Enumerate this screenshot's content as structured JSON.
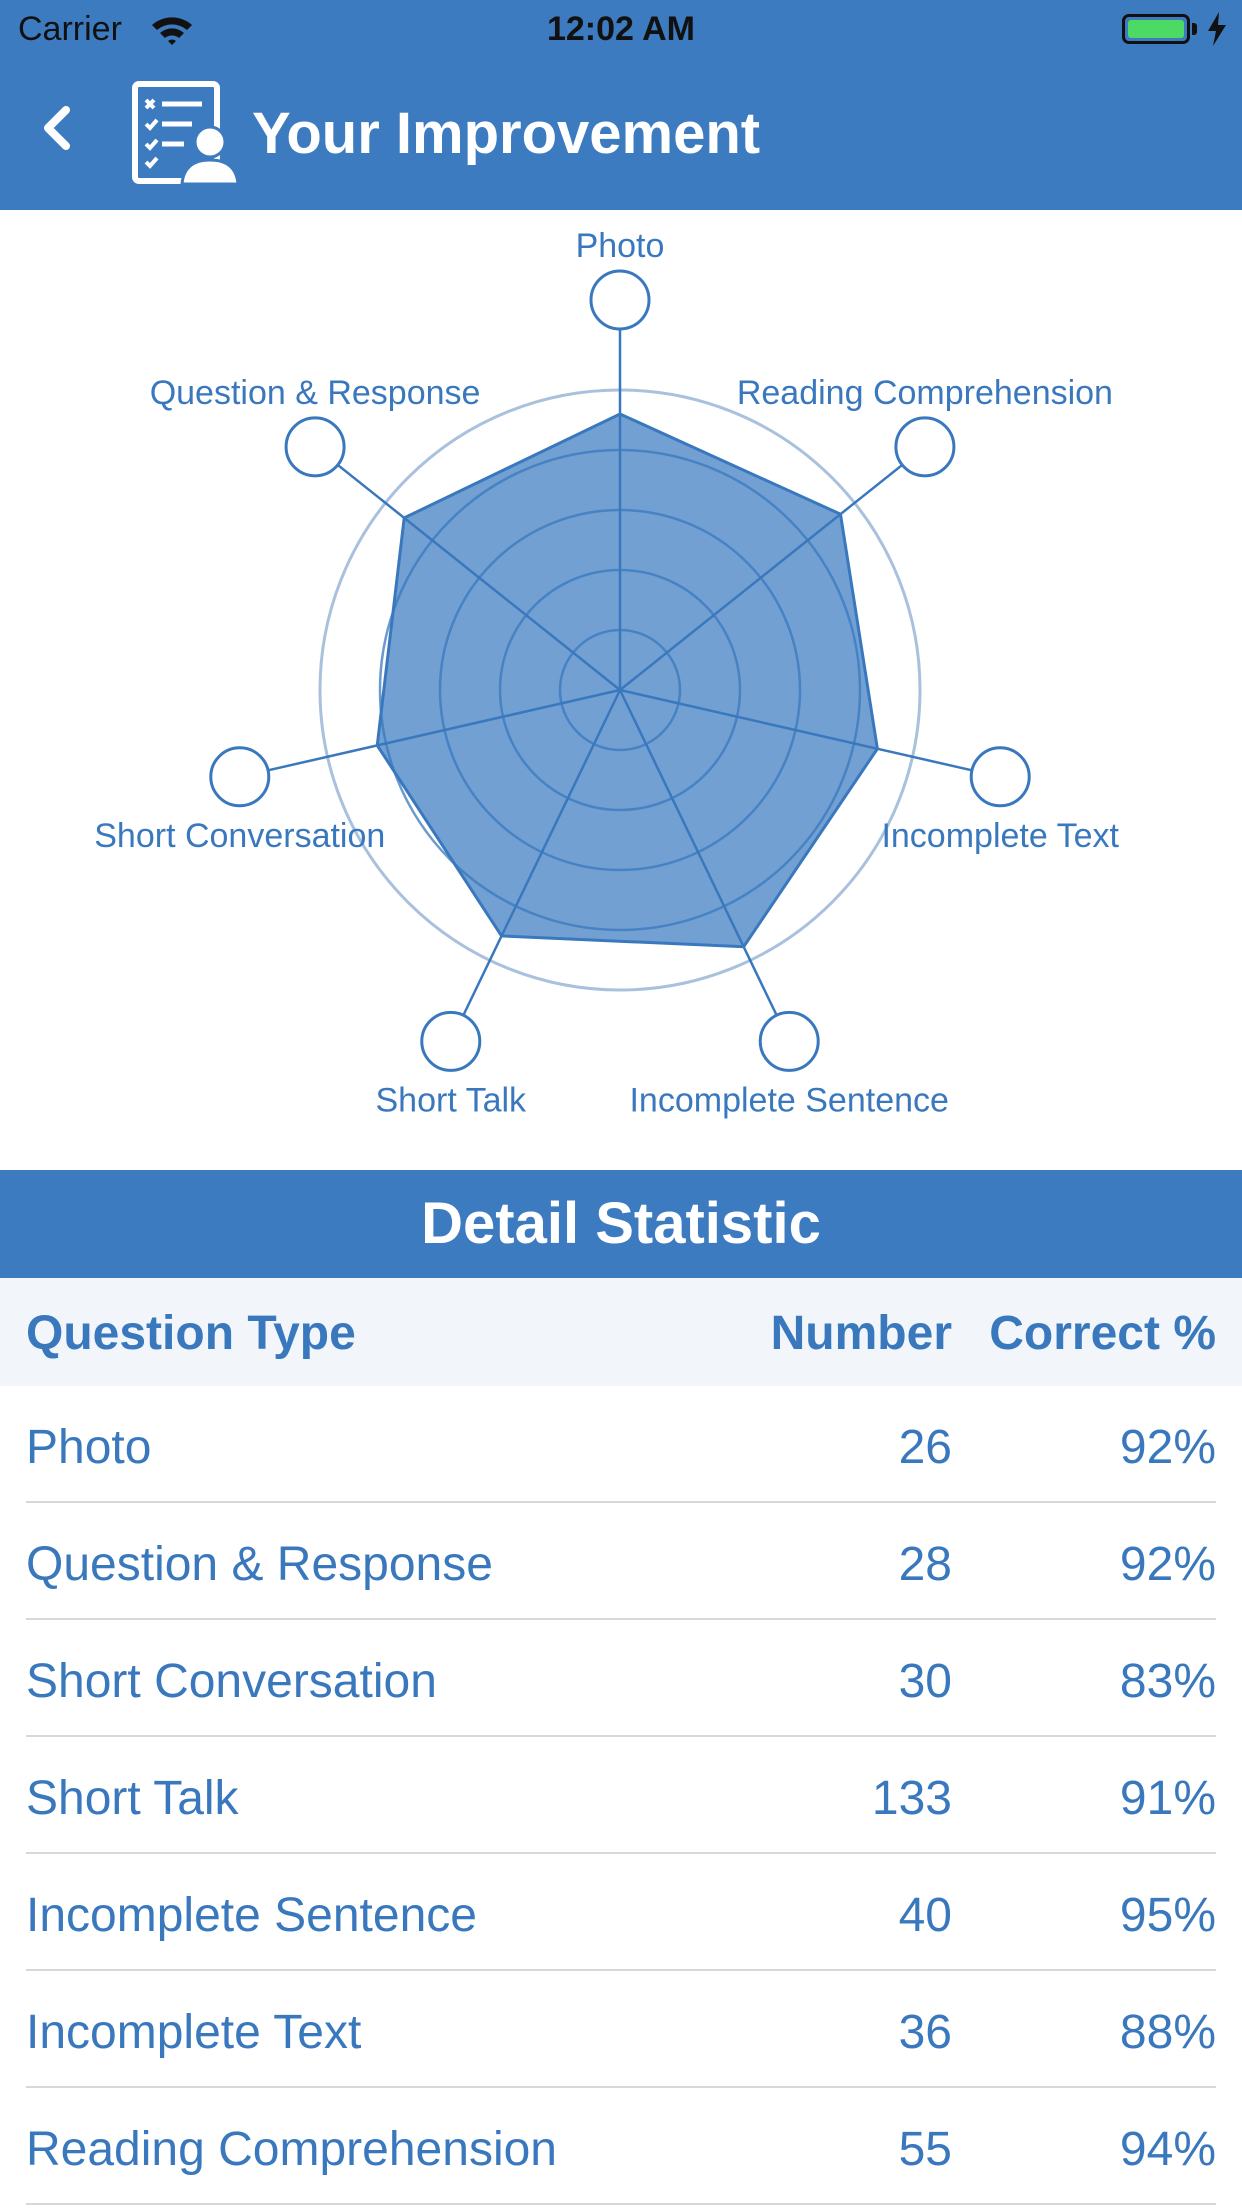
{
  "status_bar": {
    "carrier": "Carrier",
    "time": "12:02 AM"
  },
  "nav": {
    "title": "Your Improvement"
  },
  "chart_data": {
    "type": "radar",
    "axes": [
      "Photo",
      "Reading Comprehension",
      "Incomplete Text",
      "Incomplete Sentence",
      "Short Talk",
      "Short Conversation",
      "Question & Response"
    ],
    "values": [
      0.92,
      0.94,
      0.88,
      0.95,
      0.91,
      0.83,
      0.92
    ],
    "range": [
      0,
      1
    ],
    "fill_color": "#4f88c8",
    "line_color": "#3a78be"
  },
  "section": {
    "title": "Detail Statistic"
  },
  "table": {
    "headers": {
      "type": "Question Type",
      "number": "Number",
      "correct": "Correct %"
    },
    "rows": [
      {
        "type": "Photo",
        "number": "26",
        "correct": "92%"
      },
      {
        "type": "Question & Response",
        "number": "28",
        "correct": "92%"
      },
      {
        "type": "Short Conversation",
        "number": "30",
        "correct": "83%"
      },
      {
        "type": "Short Talk",
        "number": "133",
        "correct": "91%"
      },
      {
        "type": "Incomplete Sentence",
        "number": "40",
        "correct": "95%"
      },
      {
        "type": "Incomplete Text",
        "number": "36",
        "correct": "88%"
      },
      {
        "type": "Reading Comprehension",
        "number": "55",
        "correct": "94%"
      }
    ]
  }
}
